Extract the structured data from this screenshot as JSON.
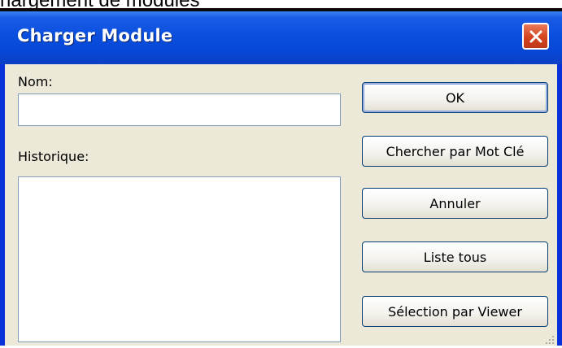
{
  "caption": "hargement de modules",
  "window": {
    "title": "Charger Module",
    "close_label": "Close"
  },
  "form": {
    "nom_label": "Nom:",
    "nom_value": "",
    "historique_label": "Historique:",
    "historique_items": []
  },
  "buttons": {
    "ok": "OK",
    "search_keyword": "Chercher par Mot Clé",
    "cancel": "Annuler",
    "list_all": "Liste tous",
    "viewer_selection": "Sélection par Viewer"
  },
  "colors": {
    "titlebar": "#0a4fde",
    "client_bg": "#ece9d8",
    "close_button": "#d4441d",
    "input_border": "#7f9db9",
    "button_border": "#003c74"
  },
  "icons": {
    "close": "close-icon",
    "resize": "resize-grip-icon"
  }
}
